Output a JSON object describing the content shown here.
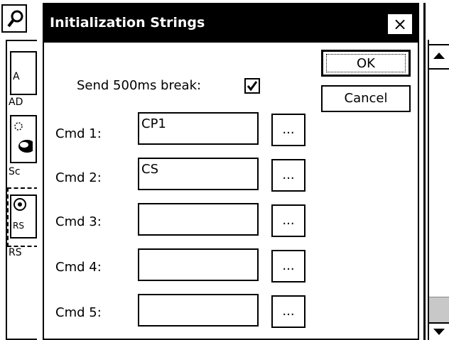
{
  "background": {
    "search_button": {
      "icon": "magnifier-icon"
    },
    "panel_items": [
      {
        "badge": "A",
        "caption": "AD"
      },
      {
        "badge": "",
        "caption": "Sc"
      },
      {
        "badge": "RS",
        "caption": "RS"
      }
    ]
  },
  "dialog": {
    "title": "Initialization Strings",
    "close_label": "×",
    "send_break_label": "Send 500ms break:",
    "send_break_checked": true,
    "commands": [
      {
        "label": "Cmd 1:",
        "value": "CP1",
        "browse": "..."
      },
      {
        "label": "Cmd 2:",
        "value": "CS",
        "browse": "..."
      },
      {
        "label": "Cmd 3:",
        "value": "",
        "browse": "..."
      },
      {
        "label": "Cmd 4:",
        "value": "",
        "browse": "..."
      },
      {
        "label": "Cmd 5:",
        "value": "",
        "browse": "..."
      }
    ],
    "ok_label": "OK",
    "cancel_label": "Cancel"
  }
}
